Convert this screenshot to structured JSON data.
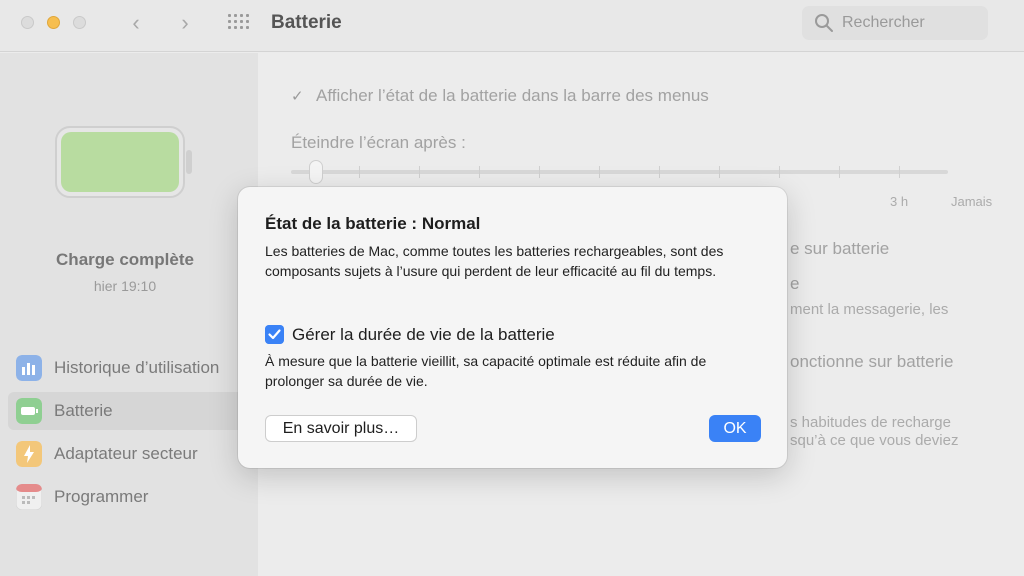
{
  "window": {
    "title": "Batterie",
    "search_placeholder": "Rechercher"
  },
  "sidebar": {
    "charge_status": "Charge complète",
    "charge_time": "hier 19:10",
    "items": [
      {
        "label": "Historique d’utilisation",
        "icon": "bar-chart-icon",
        "color": "#6f9ee0"
      },
      {
        "label": "Batterie",
        "icon": "battery-icon",
        "color": "#5fbf6a"
      },
      {
        "label": "Adaptateur secteur",
        "icon": "lightning-icon",
        "color": "#f3b43c"
      },
      {
        "label": "Programmer",
        "icon": "calendar-icon",
        "color": "#e8e8e8"
      }
    ]
  },
  "main": {
    "menu_bar_option": "Afficher l’état de la batterie dans la barre des menus",
    "screen_off_label": "Éteindre l’écran après :",
    "slider_labels": [
      "3 h",
      "Jamais"
    ],
    "bg_fragments": [
      "e sur batterie",
      "e",
      "ment la messagerie, les",
      "onctionne sur batterie",
      "s habitudes de recharge",
      "squ’à ce que vous deviez"
    ]
  },
  "dialog": {
    "title": "État de la batterie : Normal",
    "description": "Les batteries de Mac, comme toutes les batteries rechargeables, sont des composants sujets à l’usure qui perdent de leur efficacité au fil du temps.",
    "checkbox_label": "Gérer la durée de vie de la batterie",
    "checkbox_checked": true,
    "checkbox_help": "À mesure que la batterie vieillit, sa capacité optimale est réduite afin de prolonger sa durée de vie.",
    "learn_more_button": "En savoir plus…",
    "ok_button": "OK"
  },
  "colors": {
    "accent": "#3a82f6",
    "battery_fill": "#b8dca0"
  }
}
